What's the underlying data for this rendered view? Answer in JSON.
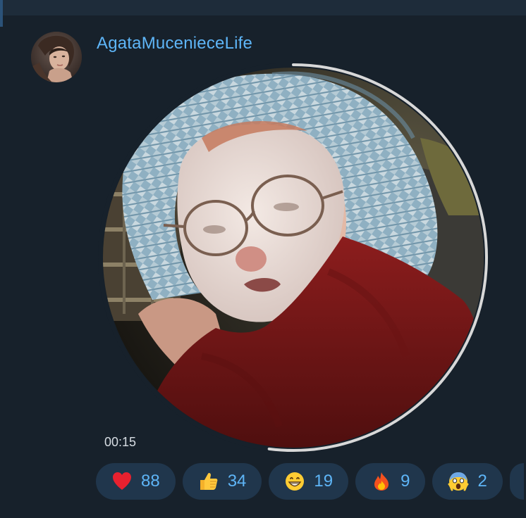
{
  "post": {
    "channel_name": "AgataMucenieceLife",
    "avatar_icon": "profile-photo",
    "video": {
      "duration": "00:15",
      "progress": 0.52
    }
  },
  "reactions": [
    {
      "icon": "red-heart-icon",
      "count": "88"
    },
    {
      "icon": "thumbs-up-icon",
      "count": "34"
    },
    {
      "icon": "grinning-face-icon",
      "count": "19"
    },
    {
      "icon": "fire-icon",
      "count": "9"
    },
    {
      "icon": "screaming-face-icon",
      "count": "2"
    }
  ],
  "colors": {
    "background": "#17212b",
    "accent": "#5eb5f7",
    "reaction_bg": "#20364c"
  }
}
